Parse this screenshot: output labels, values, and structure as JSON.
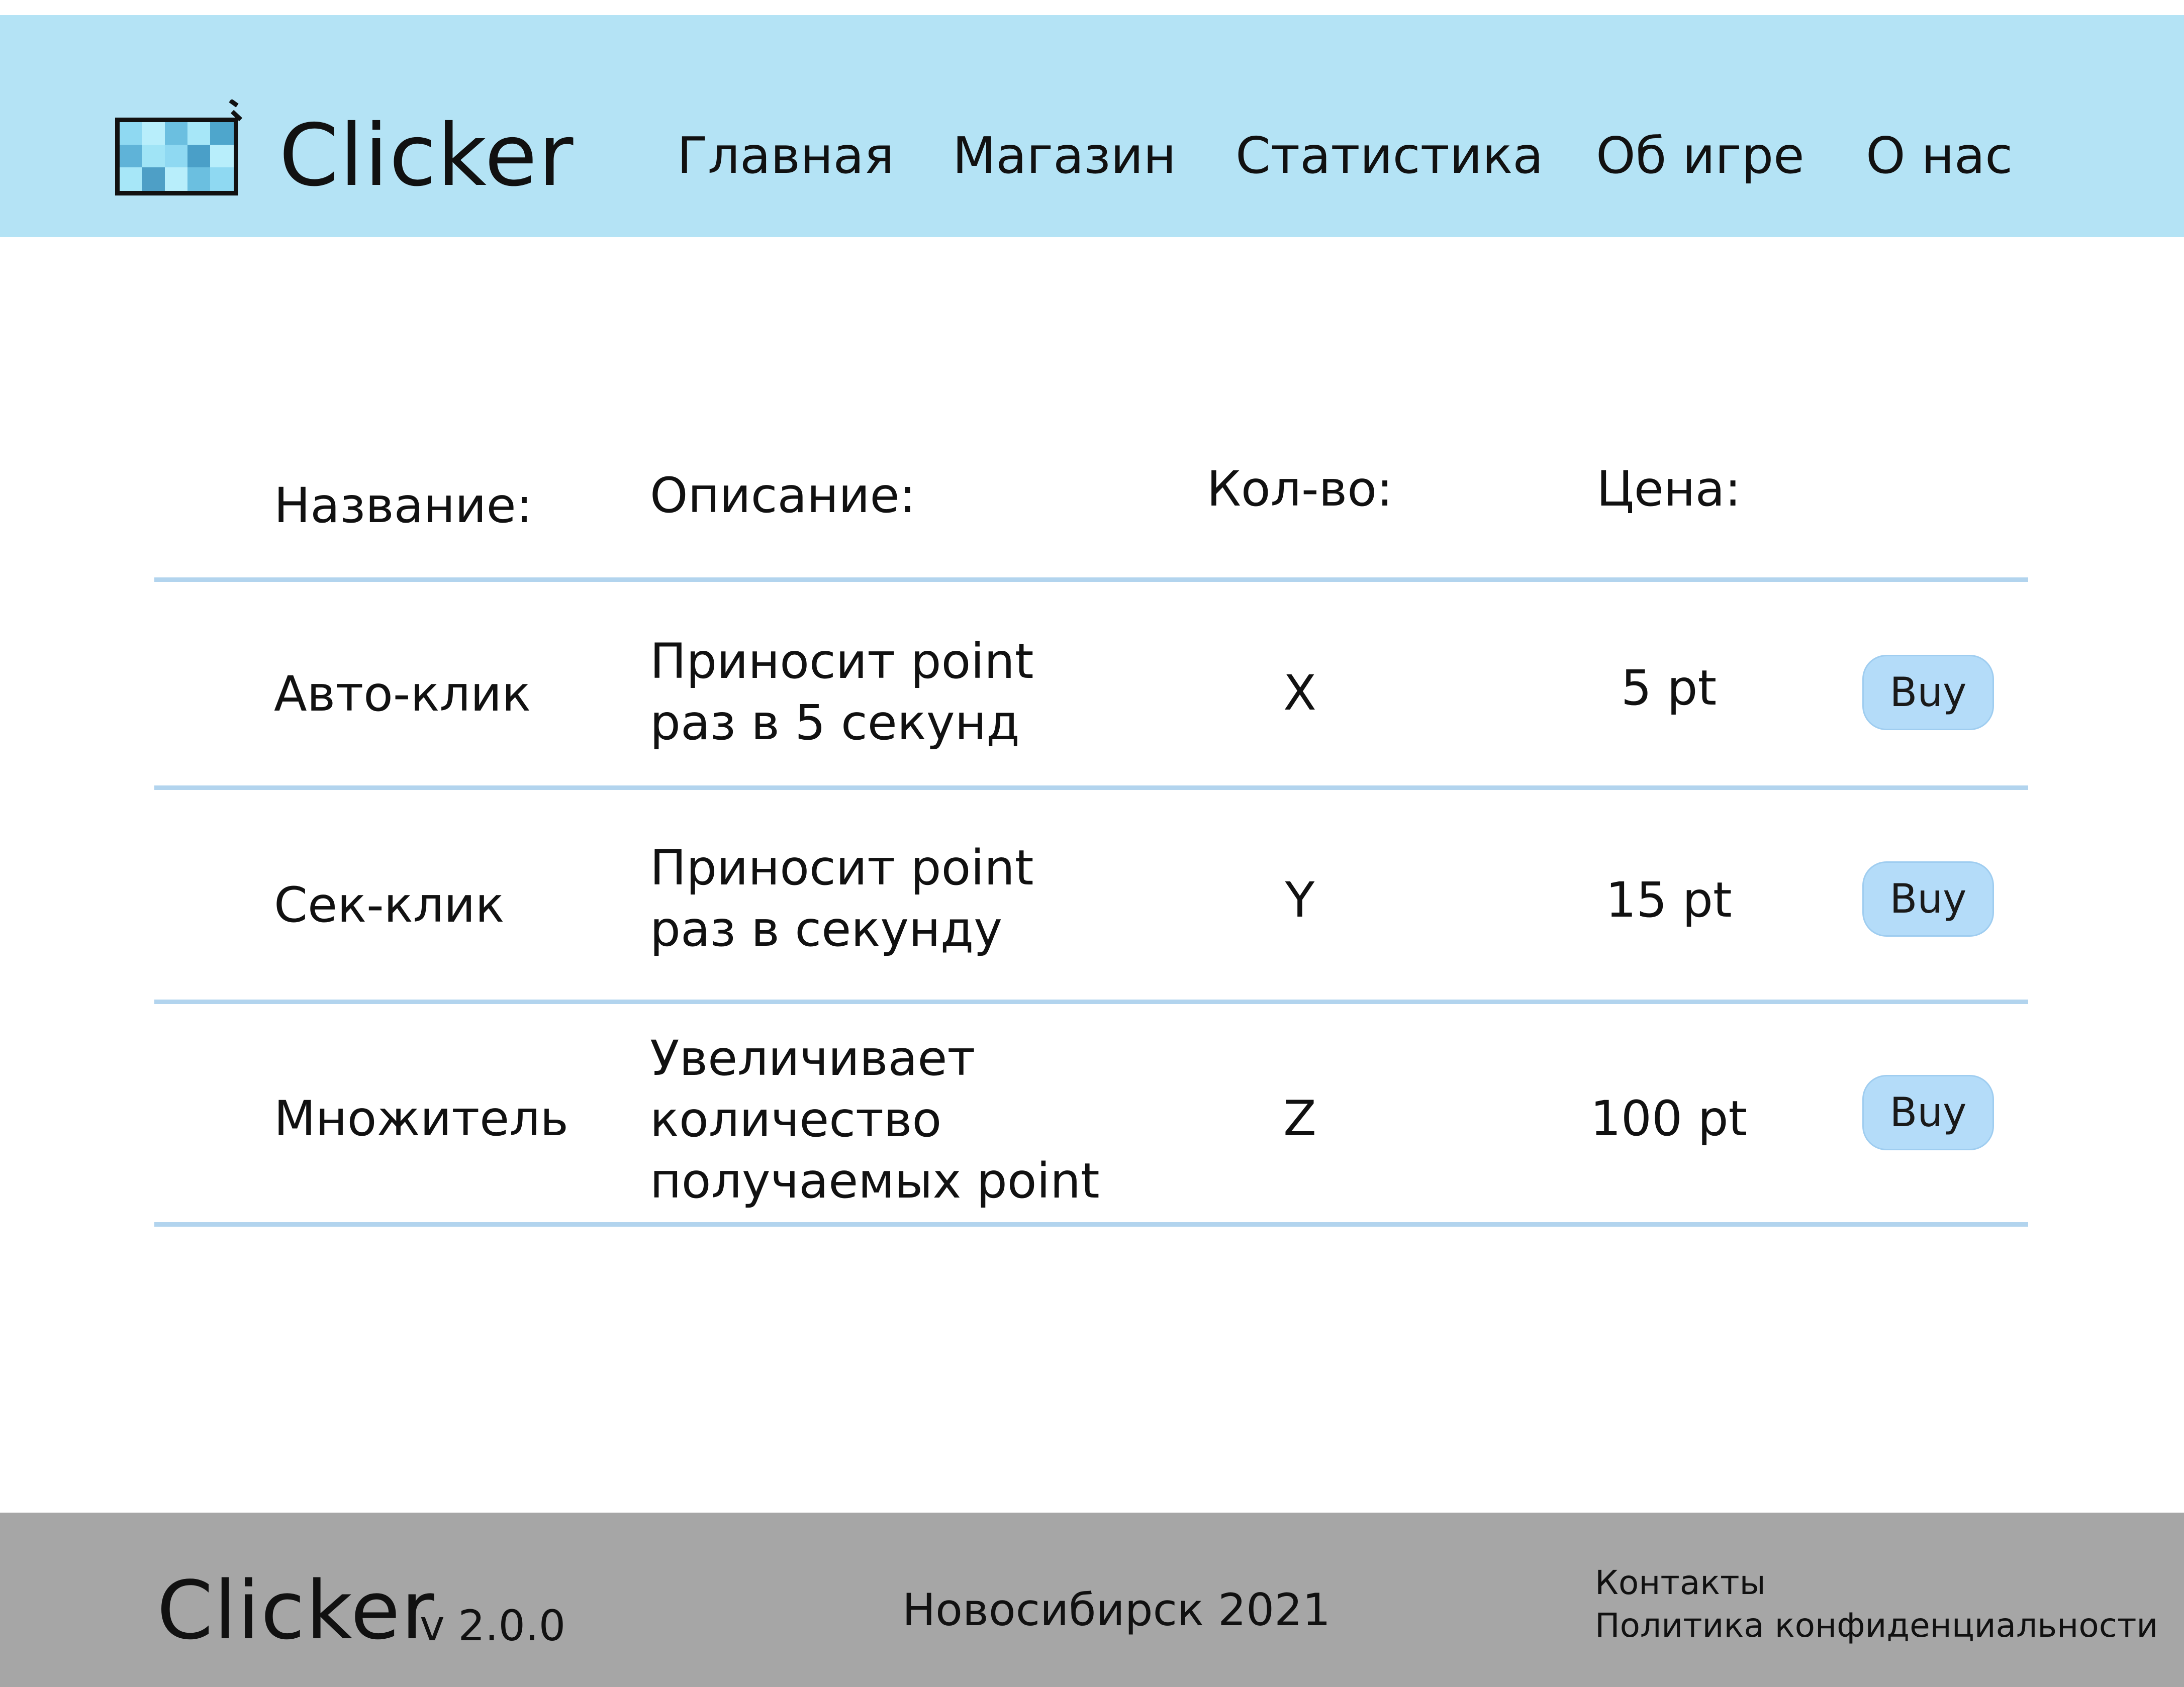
{
  "header": {
    "brand": "Clicker",
    "nav": [
      {
        "label": "Главная"
      },
      {
        "label": "Магазин"
      },
      {
        "label": "Статистика"
      },
      {
        "label": "Об игре"
      },
      {
        "label": "О нас"
      }
    ]
  },
  "table": {
    "columns": {
      "name": "Название:",
      "description": "Описание:",
      "quantity": "Кол-во:",
      "price": "Цена:"
    },
    "rows": [
      {
        "name": "Авто-клик",
        "description_lines": [
          "Приносит point",
          "раз в 5 секунд"
        ],
        "quantity": "X",
        "price": "5 pt",
        "buy_label": "Buy"
      },
      {
        "name": "Сек-клик",
        "description_lines": [
          "Приносит point",
          "раз в секунду"
        ],
        "quantity": "Y",
        "price": "15 pt",
        "buy_label": "Buy"
      },
      {
        "name": "Множитель",
        "description_lines": [
          "Увеличивает",
          "количество",
          "получаемых point"
        ],
        "quantity": "Z",
        "price": "100 pt",
        "buy_label": "Buy"
      }
    ]
  },
  "footer": {
    "brand": "Clicker",
    "version": "v 2.0.0",
    "city_year": "Новосибирск 2021",
    "links": [
      {
        "label": "Контакты"
      },
      {
        "label": "Политика конфиденциальности"
      }
    ]
  },
  "colors": {
    "header_bg": "#b4e3f5",
    "row_divider": "#b2d4ee",
    "buy_button_bg": "#b4dcf9",
    "footer_bg": "#a6a6a6"
  }
}
